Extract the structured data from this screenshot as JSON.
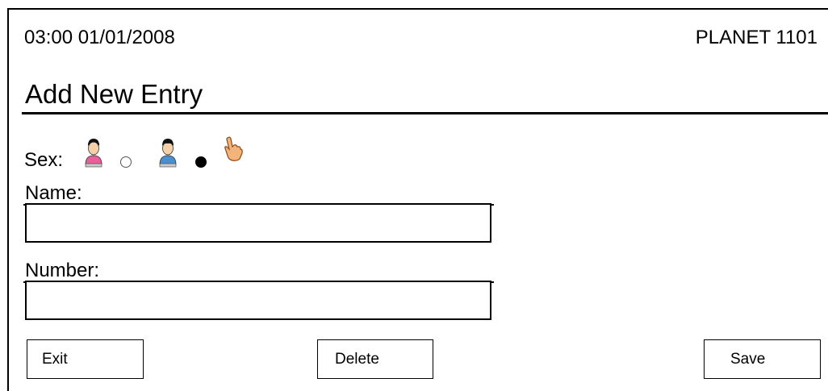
{
  "status_bar": {
    "datetime": "03:00 01/01/2008",
    "device_name": "PLANET 1101"
  },
  "page": {
    "title": "Add New Entry"
  },
  "sex": {
    "label": "Sex:",
    "options": [
      {
        "value": "female",
        "icon": "female-person-icon",
        "selected": false
      },
      {
        "value": "male",
        "icon": "male-person-icon",
        "selected": true
      }
    ],
    "cursor_icon": "pointing-hand-icon"
  },
  "form": {
    "name_label": "Name:",
    "name_value": "",
    "number_label": "Number:",
    "number_value": ""
  },
  "buttons": {
    "exit": "Exit",
    "delete": "Delete",
    "save": "Save"
  },
  "colors": {
    "female_accent": "#e8609a",
    "male_accent": "#4a8fd0",
    "hand": "#f2b47a"
  }
}
